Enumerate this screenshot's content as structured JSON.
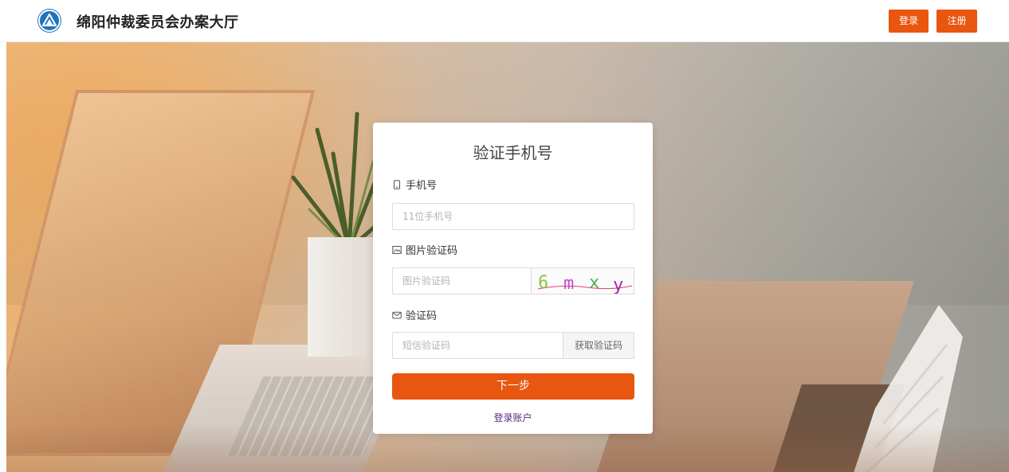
{
  "header": {
    "site_title": "绵阳仲裁委员会办案大厅",
    "login_label": "登录",
    "register_label": "注册"
  },
  "card": {
    "title": "验证手机号",
    "phone": {
      "label": "手机号",
      "placeholder": "11位手机号",
      "icon": "mobile-icon"
    },
    "image_code": {
      "label": "图片验证码",
      "placeholder": "图片验证码",
      "captcha_text": "6 m x y",
      "icon": "image-icon"
    },
    "sms_code": {
      "label": "验证码",
      "placeholder": "短信验证码",
      "send_label": "获取验证码",
      "icon": "mail-icon"
    },
    "next_label": "下一步",
    "login_link": "登录账户"
  },
  "colors": {
    "accent": "#e8560f",
    "link": "#5b2a80",
    "logo": "#1e73be"
  }
}
